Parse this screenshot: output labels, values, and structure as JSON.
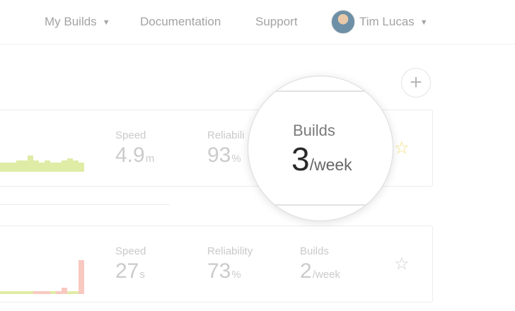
{
  "nav": {
    "my_builds": "My Builds",
    "documentation": "Documentation",
    "support": "Support",
    "user_name": "Tim Lucas",
    "caret": "▼"
  },
  "add_button": "+",
  "pipelines": [
    {
      "speed": {
        "label": "Speed",
        "value": "4.9",
        "unit": "m"
      },
      "reliability": {
        "label": "Reliabili",
        "value": "93",
        "unit": "%"
      },
      "builds": {
        "label": "Builds",
        "value": "3",
        "unit": "/week"
      },
      "starred": true,
      "star_glyph": "☆",
      "chart_data": {
        "type": "bar",
        "values": [
          13,
          13,
          13,
          16,
          16,
          23,
          16,
          13,
          16,
          13,
          13,
          16,
          19,
          16,
          13
        ],
        "colors": [
          "#dfeca6"
        ]
      }
    },
    {
      "speed": {
        "label": "Speed",
        "value": "27",
        "unit": "s"
      },
      "reliability": {
        "label": "Reliability",
        "value": "73",
        "unit": "%"
      },
      "builds": {
        "label": "Builds",
        "value": "2",
        "unit": "/week"
      },
      "starred": false,
      "star_glyph": "☆",
      "chart_data": {
        "type": "bar",
        "values": [
          4,
          4,
          4,
          4,
          4,
          4,
          4,
          4,
          4,
          4,
          4,
          9,
          4,
          4,
          48
        ],
        "colors": [
          "#dfeca6",
          "#dfeca6",
          "#dfeca6",
          "#dfeca6",
          "#dfeca6",
          "#dfeca6",
          "#f8c9c0",
          "#f8c9c0",
          "#f8c9c0",
          "#dfeca6",
          "#f8c9c0",
          "#f8c9c0",
          "#dfeca6",
          "#dfeca6",
          "#f8c9c0"
        ]
      }
    }
  ],
  "magnifier": {
    "label": "Builds",
    "value": "3",
    "unit": "/week"
  }
}
